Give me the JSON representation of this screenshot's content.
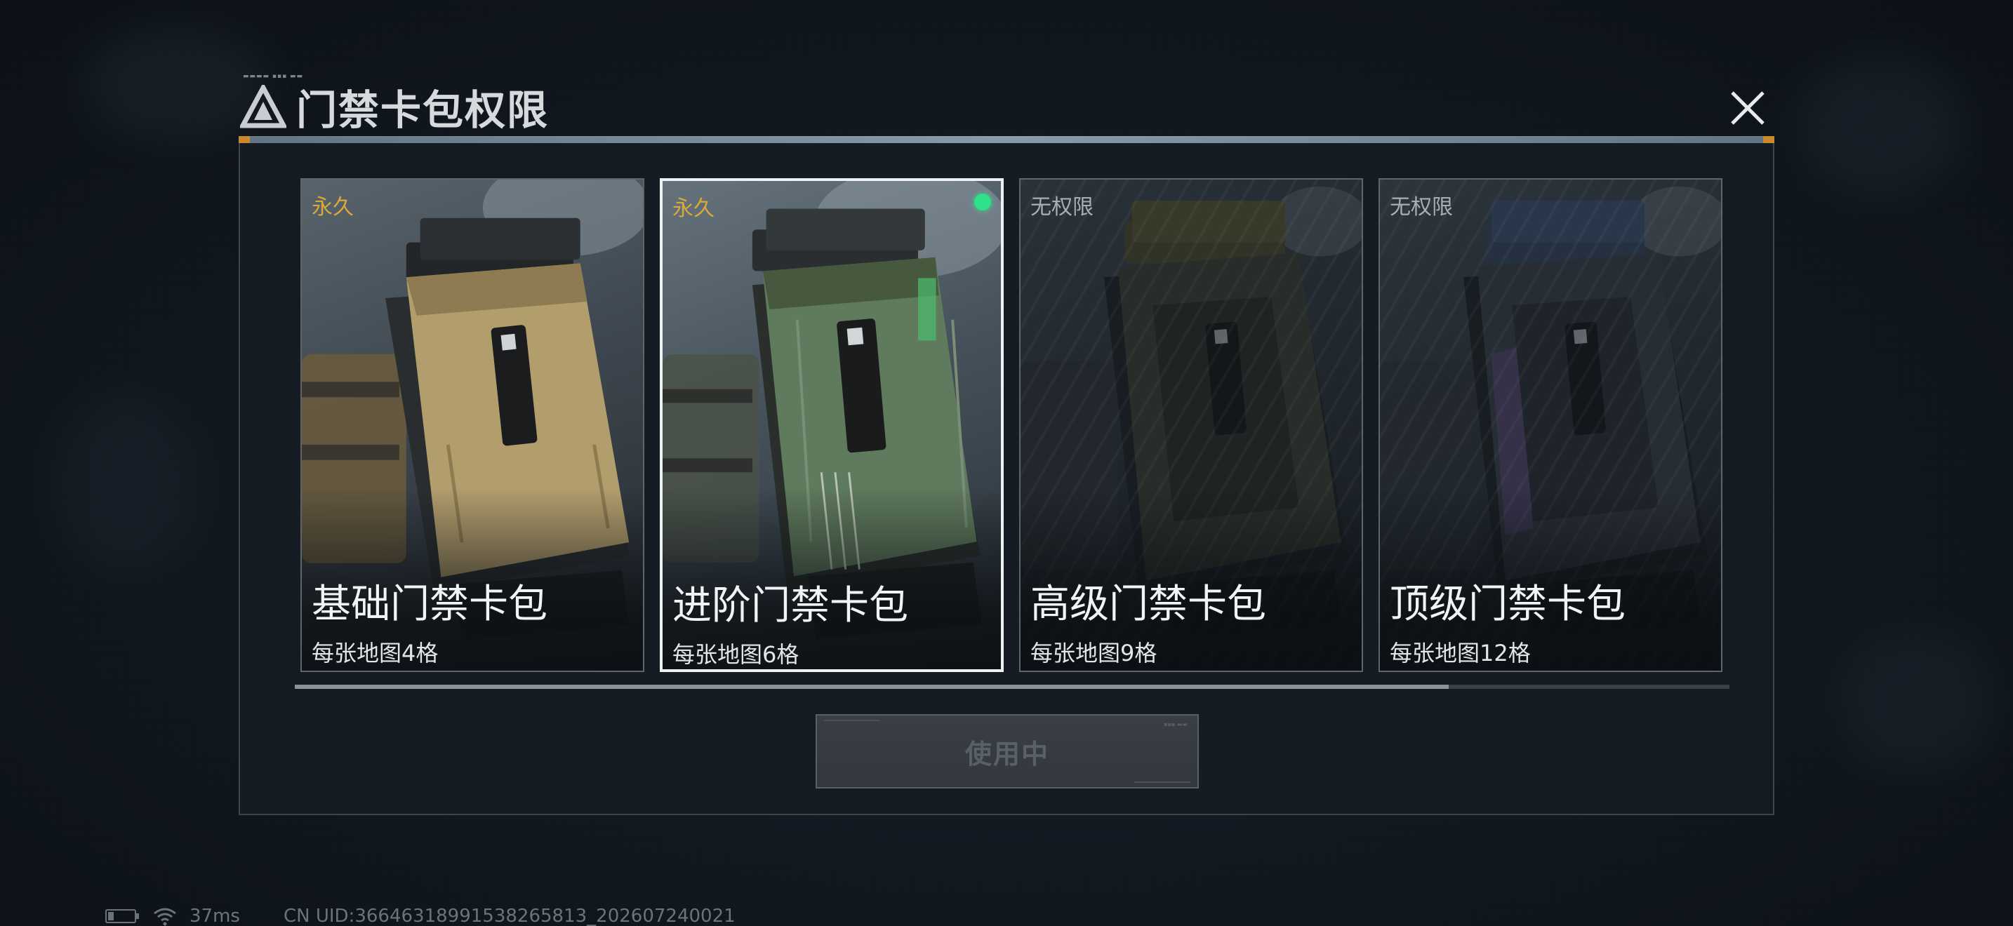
{
  "dialog": {
    "title": "门禁卡包权限",
    "close_icon": "close-icon"
  },
  "cards": [
    {
      "tag": "永久",
      "tag_color": "#d9a93a",
      "name": "基础门禁卡包",
      "desc": "每张地图4格",
      "selected": false,
      "active_dot": false,
      "accent": "#b8a37a"
    },
    {
      "tag": "永久",
      "tag_color": "#d9a93a",
      "name": "进阶门禁卡包",
      "desc": "每张地图6格",
      "selected": true,
      "active_dot": true,
      "accent": "#6f8d6a"
    },
    {
      "tag": "无权限",
      "tag_color": "#a9aeb3",
      "name": "高级门禁卡包",
      "desc": "每张地图9格",
      "selected": false,
      "active_dot": false,
      "accent": "#5d5f44"
    },
    {
      "tag": "无权限",
      "tag_color": "#a9aeb3",
      "name": "顶级门禁卡包",
      "desc": "每张地图12格",
      "selected": false,
      "active_dot": false,
      "accent": "#4a5c78"
    }
  ],
  "action_button": {
    "label": "使用中",
    "enabled": false
  },
  "colors": {
    "active_dot": "#2ee08a",
    "accent_orange": "#c88a2c"
  },
  "status_bar": {
    "ping": "37ms",
    "uid": "CN UID:3664631899153826581​3_202607240021"
  }
}
